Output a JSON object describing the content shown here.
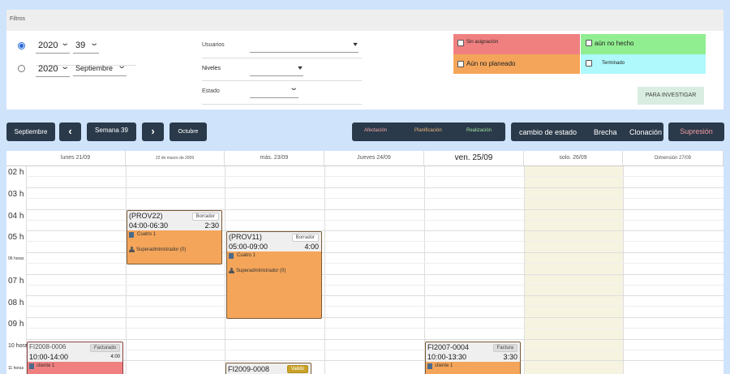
{
  "filters": {
    "title": "Filtros",
    "row1": {
      "year": "2020",
      "week": "39"
    },
    "row2": {
      "year": "2020",
      "month": "Septiembre"
    },
    "usuarios_label": "Usuarios",
    "niveles_label": "Niveles",
    "estado_label": "Estado",
    "legend": {
      "sin_asignacion": "Sin asignación",
      "aun_no_hecho": "aún no hecho",
      "aun_no_planeado": "Aún no planeado",
      "terminado": "Terminado"
    },
    "investigar_button": "PARA INVESTIGAR",
    "colors": {
      "red": "#f08080",
      "green": "#90ee90",
      "orange": "#f4a55a",
      "cyan": "#aff8fb"
    }
  },
  "toolbar": {
    "prev_month": "Septiembre",
    "week_label": "Semana 39",
    "next_month": "Octubre",
    "afectacion": "Afectación",
    "planificacion": "Planificación",
    "realizacion": "Realización",
    "cambio_estado": "cambio de estado",
    "brecha": "Brecha",
    "clonacion": "Clonación",
    "supresion": "Supresión"
  },
  "calendar": {
    "days": [
      "lunes 21/09",
      "22 de marzo de 2009",
      "más. 23/09",
      "Jueves 24/09",
      "ven. 25/09",
      "solo. 26/09",
      "Dimensión 27/09"
    ],
    "hours": [
      "02 h",
      "03 h",
      "04 h",
      "05 h",
      "06 horas",
      "07 h",
      "08 h",
      "09 h",
      "10 horas",
      "11 horas"
    ],
    "events": [
      {
        "code": "(PROV22)",
        "status": "Borrador",
        "time": "04:00-06:30",
        "duration": "2:30",
        "client": "Cuatro 1",
        "user": "Superadministrador (0)"
      },
      {
        "code": "(PROV11)",
        "status": "Borrador",
        "time": "05:00-09:00",
        "duration": "4:00",
        "client": "Cuatro 1",
        "user": "Superadministrador (0)"
      },
      {
        "code": "FI2008-0006",
        "status": "Facturado",
        "time": "10:00-14:00",
        "duration": "4:00",
        "client": "cliente 1"
      },
      {
        "code": "FI2007-0004",
        "status": "Factura",
        "time": "10:00-13:30",
        "duration": "3:30",
        "client": "cliente 1"
      },
      {
        "code": "FI2009-0008",
        "status": "Valido"
      }
    ]
  }
}
